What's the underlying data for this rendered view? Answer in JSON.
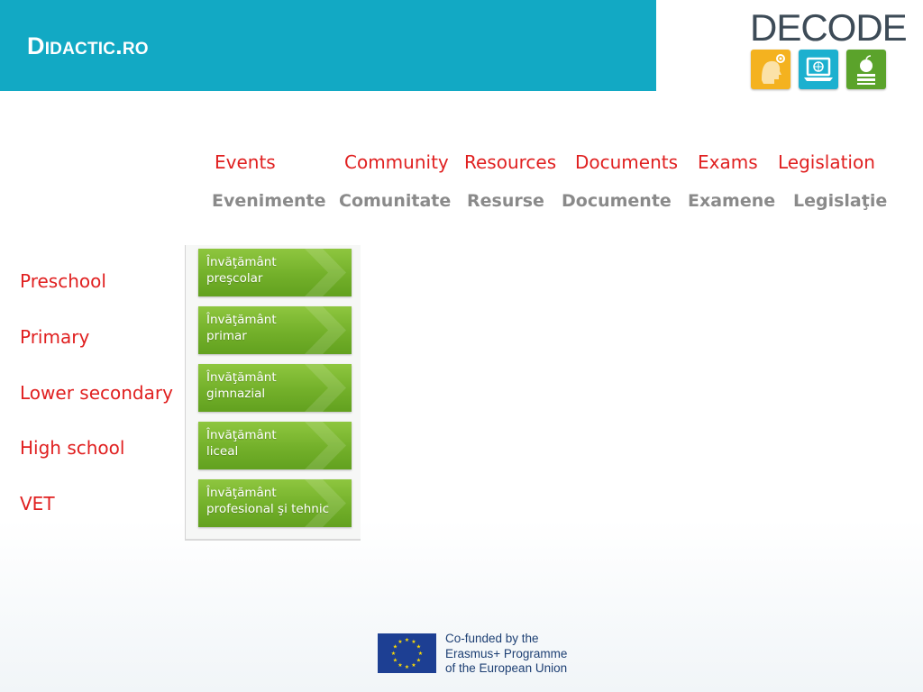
{
  "header": {
    "title": "Didactic.ro",
    "band_color": "#12a9c4"
  },
  "logo": {
    "text": "DECODE",
    "tiles": [
      "head-gear-icon",
      "laptop-globe-icon",
      "apple-books-icon"
    ]
  },
  "nav": {
    "english": [
      "Events",
      "Community",
      "Resources",
      "Documents",
      "Exams",
      "Legislation"
    ],
    "romanian": [
      "Evenimente",
      "Comunitate",
      "Resurse",
      "Documente",
      "Examene",
      "Legislaţie"
    ]
  },
  "levels": {
    "english": [
      "Preschool",
      "Primary",
      "Lower secondary",
      "High school",
      "VET"
    ],
    "buttons": [
      {
        "line1": "Învăţământ",
        "line2": "preşcolar"
      },
      {
        "line1": "Învăţământ",
        "line2": "primar"
      },
      {
        "line1": "Învăţământ",
        "line2": "gimnazial"
      },
      {
        "line1": "Învăţământ",
        "line2": "liceal"
      },
      {
        "line1": "Învăţământ",
        "line2": "profesional şi tehnic"
      }
    ]
  },
  "footer": {
    "lines": [
      "Co-funded by the",
      "Erasmus+ Programme",
      "of the European Union"
    ],
    "flag_icon": "eu-flag-icon"
  },
  "colors": {
    "accent_red": "#e02020",
    "button_green": "#73b02a"
  }
}
